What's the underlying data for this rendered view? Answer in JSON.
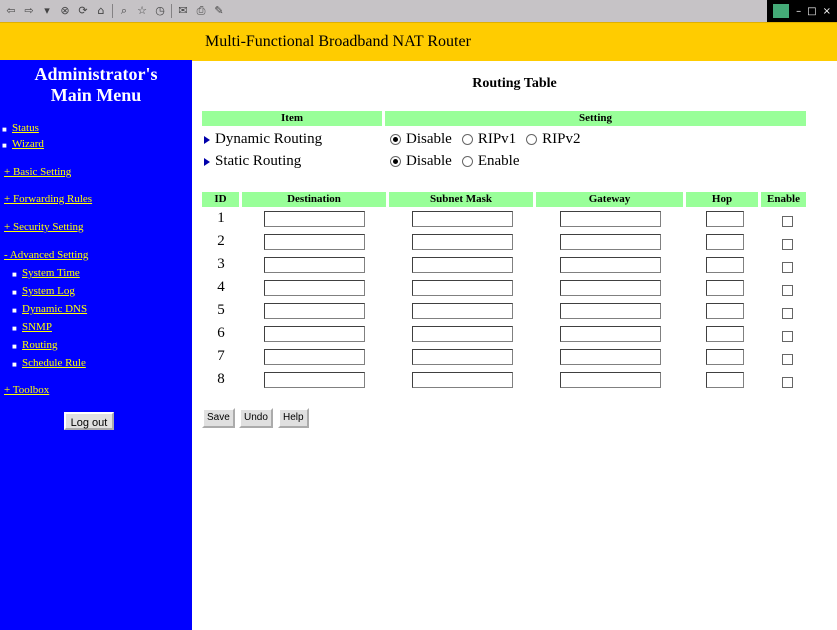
{
  "browser": {
    "toolbar_icons": [
      "back-icon",
      "forward-icon",
      "stop-icon",
      "refresh-icon",
      "home-icon",
      "search-icon",
      "favorites-icon",
      "history-icon",
      "mail-icon",
      "print-icon",
      "edit-icon"
    ]
  },
  "banner": {
    "title": "Multi-Functional Broadband NAT Router"
  },
  "sidebar": {
    "heading_line1": "Administrator's",
    "heading_line2": "Main Menu",
    "status": "Status",
    "wizard": "Wizard",
    "basic_setting": "+ Basic Setting",
    "forwarding_rules": "+ Forwarding Rules",
    "security_setting": "+ Security Setting",
    "advanced_setting": "- Advanced Setting",
    "advanced_items": [
      "System Time",
      "System Log",
      "Dynamic DNS",
      "SNMP",
      "Routing",
      "Schedule Rule"
    ],
    "toolbox": "+ Toolbox",
    "logout": "Log out"
  },
  "main": {
    "title": "Routing Table",
    "settings_header": {
      "item": "Item",
      "setting": "Setting"
    },
    "dynamic_routing": {
      "label": "Dynamic Routing",
      "options": [
        "Disable",
        "RIPv1",
        "RIPv2"
      ],
      "selected": "Disable"
    },
    "static_routing": {
      "label": "Static Routing",
      "options": [
        "Disable",
        "Enable"
      ],
      "selected": "Disable"
    },
    "table_headers": [
      "ID",
      "Destination",
      "Subnet Mask",
      "Gateway",
      "Hop",
      "Enable"
    ],
    "rows": [
      "1",
      "2",
      "3",
      "4",
      "5",
      "6",
      "7",
      "8"
    ],
    "buttons": {
      "save": "Save",
      "undo": "Undo",
      "help": "Help"
    }
  }
}
